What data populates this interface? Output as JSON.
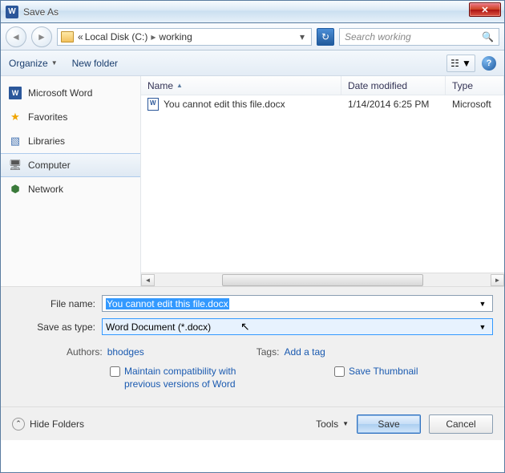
{
  "window": {
    "title": "Save As"
  },
  "nav": {
    "path_prefix": "«",
    "crumb1": "Local Disk (C:)",
    "crumb2": "working",
    "search_placeholder": "Search working"
  },
  "toolbar": {
    "organize": "Organize",
    "new_folder": "New folder"
  },
  "sidebar": {
    "items": [
      {
        "label": "Microsoft Word",
        "icon": "W"
      },
      {
        "label": "Favorites",
        "icon": "★"
      },
      {
        "label": "Libraries",
        "icon": "🗃"
      },
      {
        "label": "Computer",
        "icon": "🖥"
      },
      {
        "label": "Network",
        "icon": "🖧"
      }
    ]
  },
  "columns": {
    "name": "Name",
    "date": "Date modified",
    "type": "Type"
  },
  "files": [
    {
      "name": "You cannot edit this file.docx",
      "date": "1/14/2014 6:25 PM",
      "type": "Microsoft"
    }
  ],
  "form": {
    "filename_label": "File name:",
    "filename_value": "You cannot edit this file.docx",
    "savetype_label": "Save as type:",
    "savetype_value": "Word Document (*.docx)",
    "authors_label": "Authors:",
    "authors_value": "bhodges",
    "tags_label": "Tags:",
    "tags_value": "Add a tag",
    "maintain_label": "Maintain compatibility with previous versions of Word",
    "thumb_label": "Save Thumbnail"
  },
  "footer": {
    "hide": "Hide Folders",
    "tools": "Tools",
    "save": "Save",
    "cancel": "Cancel"
  }
}
